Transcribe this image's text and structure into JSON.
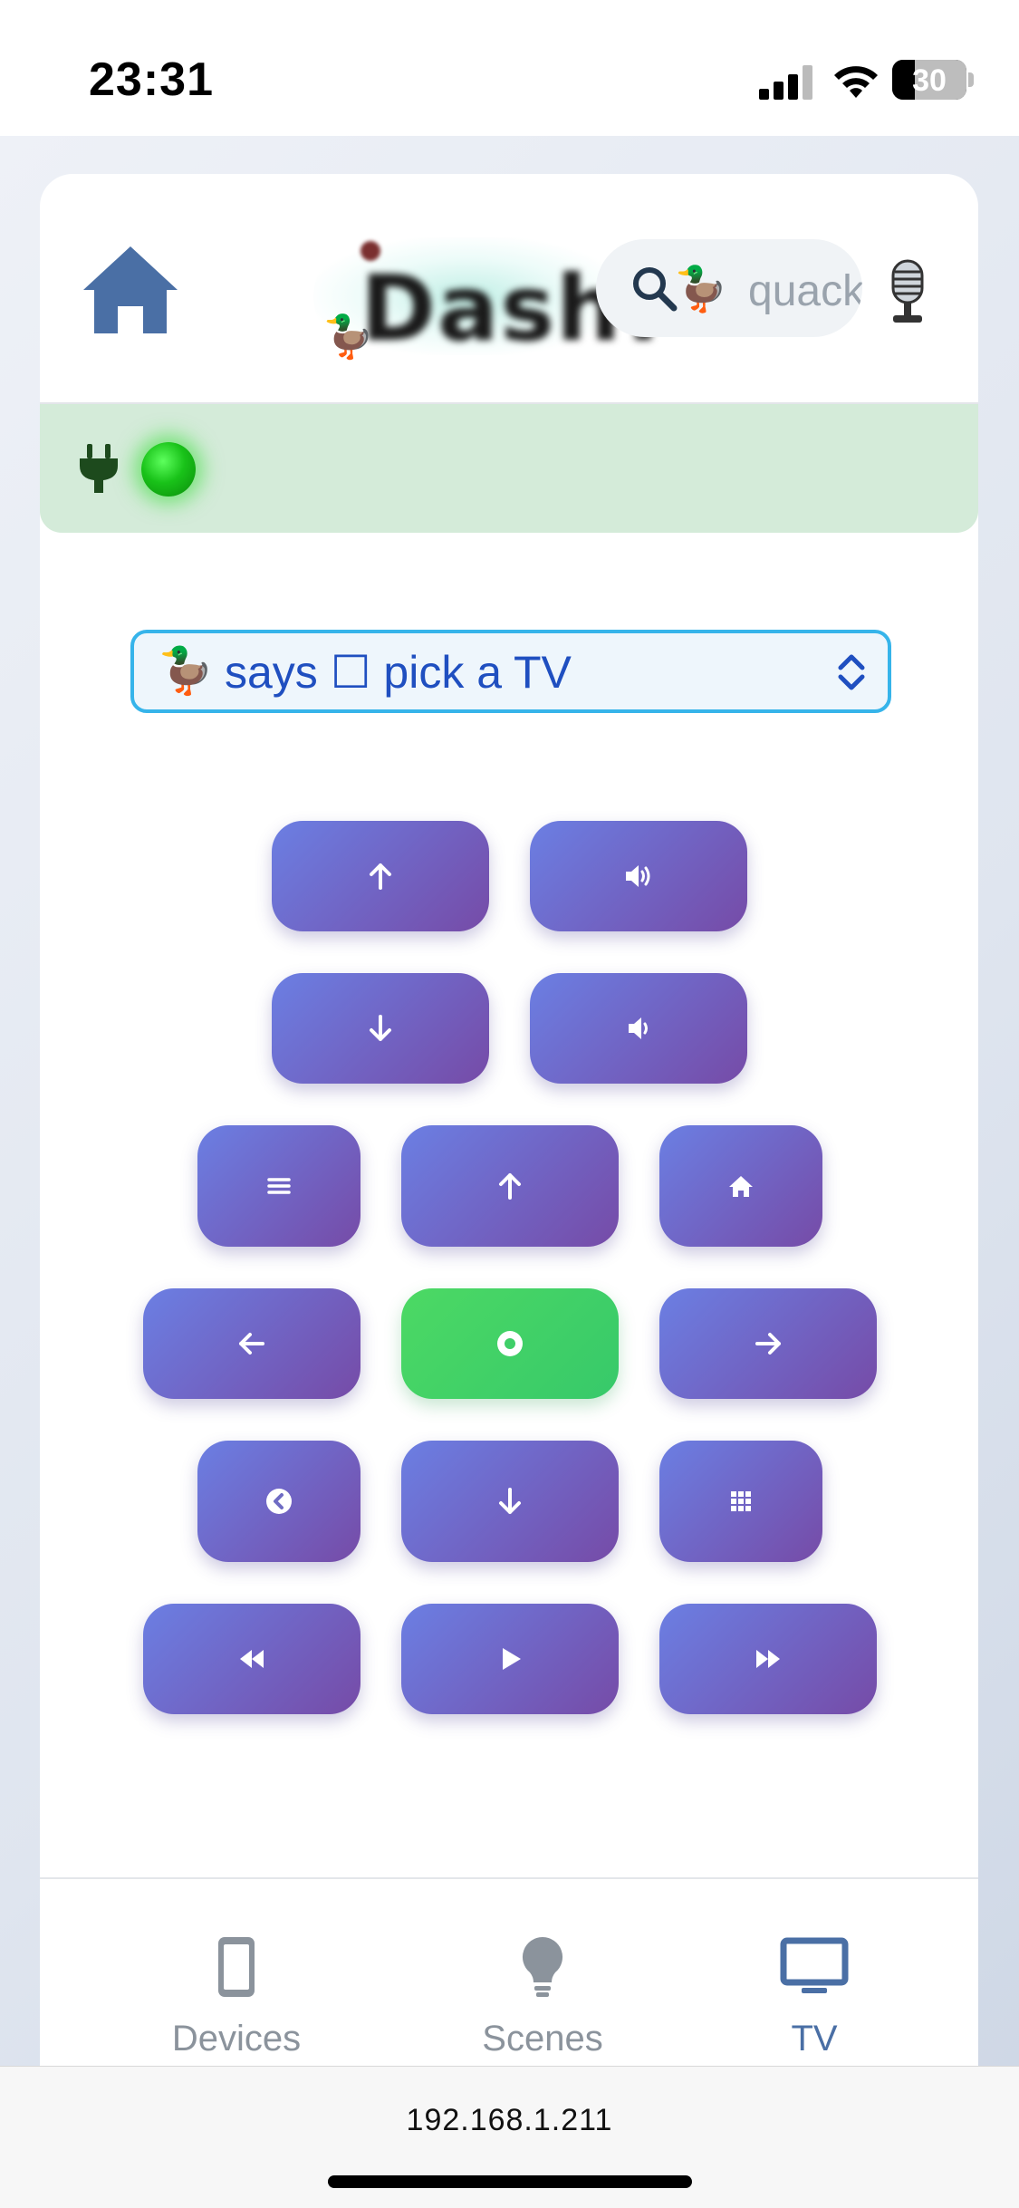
{
  "status_bar": {
    "time": "23:31",
    "battery": "30"
  },
  "header": {
    "logo_text": "Dash!",
    "search": {
      "placeholder": "quack"
    }
  },
  "device_status": {
    "led": "online"
  },
  "tv_select": {
    "value": "says ☐ pick a TV"
  },
  "remote": {
    "buttons": [
      {
        "name": "up-arrow",
        "icon": "arrow-up"
      },
      {
        "name": "volume-up",
        "icon": "volume-up"
      },
      {
        "name": "down-arrow",
        "icon": "arrow-down"
      },
      {
        "name": "volume-down",
        "icon": "volume-down"
      },
      {
        "name": "menu",
        "icon": "menu"
      },
      {
        "name": "dpad-up",
        "icon": "arrow-up"
      },
      {
        "name": "home",
        "icon": "home"
      },
      {
        "name": "dpad-left",
        "icon": "arrow-left"
      },
      {
        "name": "ok",
        "icon": "dot-circle"
      },
      {
        "name": "dpad-right",
        "icon": "arrow-right"
      },
      {
        "name": "back",
        "icon": "back-circle"
      },
      {
        "name": "dpad-down",
        "icon": "arrow-down"
      },
      {
        "name": "apps",
        "icon": "grid"
      },
      {
        "name": "rewind",
        "icon": "rewind"
      },
      {
        "name": "play",
        "icon": "play"
      },
      {
        "name": "fast-forward",
        "icon": "fast-forward"
      }
    ]
  },
  "tabs": [
    {
      "label": "Devices",
      "icon": "phone-icon"
    },
    {
      "label": "Scenes",
      "icon": "lightbulb-icon"
    },
    {
      "label": "TV",
      "icon": "tv-icon",
      "active": true
    }
  ],
  "browser": {
    "url": "192.168.1.211"
  },
  "colors": {
    "accent": "#4a6fa5",
    "button_start": "#6b7fe3",
    "button_end": "#764ba7",
    "ok_green": "#4cd964"
  }
}
